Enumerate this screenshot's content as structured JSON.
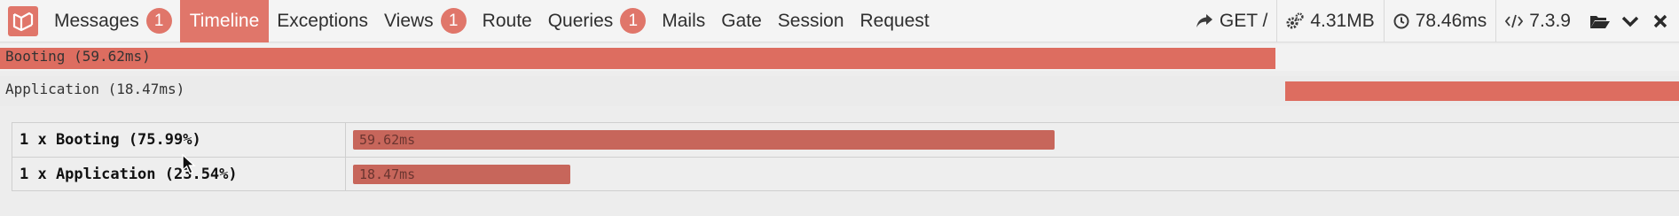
{
  "toolbar": {
    "logo_icon": "laravel-logo-icon",
    "tabs": [
      {
        "label": "Messages",
        "badge": "1"
      },
      {
        "label": "Timeline",
        "active": true
      },
      {
        "label": "Exceptions"
      },
      {
        "label": "Views",
        "badge": "1"
      },
      {
        "label": "Route"
      },
      {
        "label": "Queries",
        "badge": "1"
      },
      {
        "label": "Mails"
      },
      {
        "label": "Gate"
      },
      {
        "label": "Session"
      },
      {
        "label": "Request"
      }
    ],
    "request": "GET /",
    "memory": "4.31MB",
    "duration": "78.46ms",
    "php_version": "7.3.9",
    "icons": {
      "request": "share-arrow-icon",
      "memory": "gears-icon",
      "duration": "clock-icon",
      "php": "code-icon",
      "open": "folder-open-icon",
      "minimize": "chevron-down-icon",
      "close": "close-icon"
    }
  },
  "timeline": {
    "tracks": [
      {
        "label": "Booting (59.62ms)",
        "start_fraction": 0.0,
        "width_fraction": 0.7599
      },
      {
        "label": "Application (18.47ms)",
        "start_fraction": 0.7654,
        "width_fraction": 0.2346
      }
    ]
  },
  "summary": {
    "rows": [
      {
        "name": "1 x Booting (75.99%)",
        "duration": "59.62ms",
        "fraction": 0.7599
      },
      {
        "name": "1 x Application (23.54%)",
        "duration": "18.47ms",
        "fraction": 0.2354
      }
    ]
  },
  "colors": {
    "accent": "#e0766a",
    "bar": "#dd6d60",
    "summary_bar": "#c7665b",
    "toolbar_bg": "#f4f4f4",
    "panel_bg": "#ededed"
  }
}
